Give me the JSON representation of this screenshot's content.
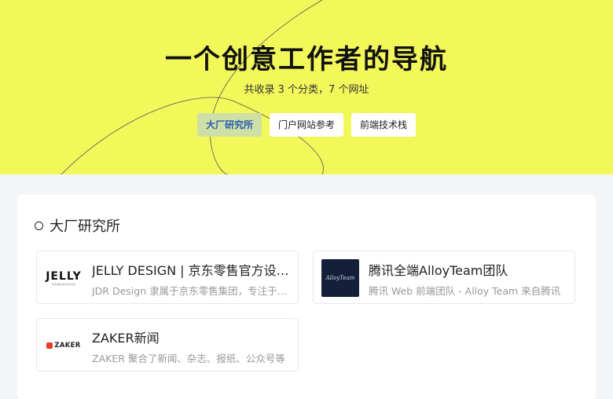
{
  "hero": {
    "title": "一个创意工作者的导航",
    "subtitle": "共收录 3 个分类，7 个网址",
    "background_color": "#f2f75a"
  },
  "tabs": [
    {
      "label": "大厂研究所",
      "active": true
    },
    {
      "label": "门户网站参考",
      "active": false
    },
    {
      "label": "前端技术栈",
      "active": false
    }
  ],
  "section": {
    "title": "大厂研究所",
    "icon": "circle-icon",
    "cards": [
      {
        "name": "JELLY DESIGN | 京东零售官方设计共享平台",
        "desc": "JDR Design 隶属于京东零售集团，专注于零售设计与体验",
        "logo": {
          "text": "JELLY",
          "sub": "京东零售设计共享平台"
        }
      },
      {
        "name": "腾讯全端AlloyTeam团队",
        "desc": "腾讯 Web 前端团队 - Alloy Team 来自腾讯",
        "logo": {
          "text": "AlloyTeam"
        }
      },
      {
        "name": "ZAKER新闻",
        "desc": "ZAKER 聚合了新闻、杂志、报纸、公众号等",
        "logo": {
          "text": "ZAKER"
        }
      }
    ]
  },
  "colors": {
    "accent": "#f2f75a",
    "active_tab_bg": "#cfe0a6",
    "active_tab_text": "#2a5db0"
  }
}
